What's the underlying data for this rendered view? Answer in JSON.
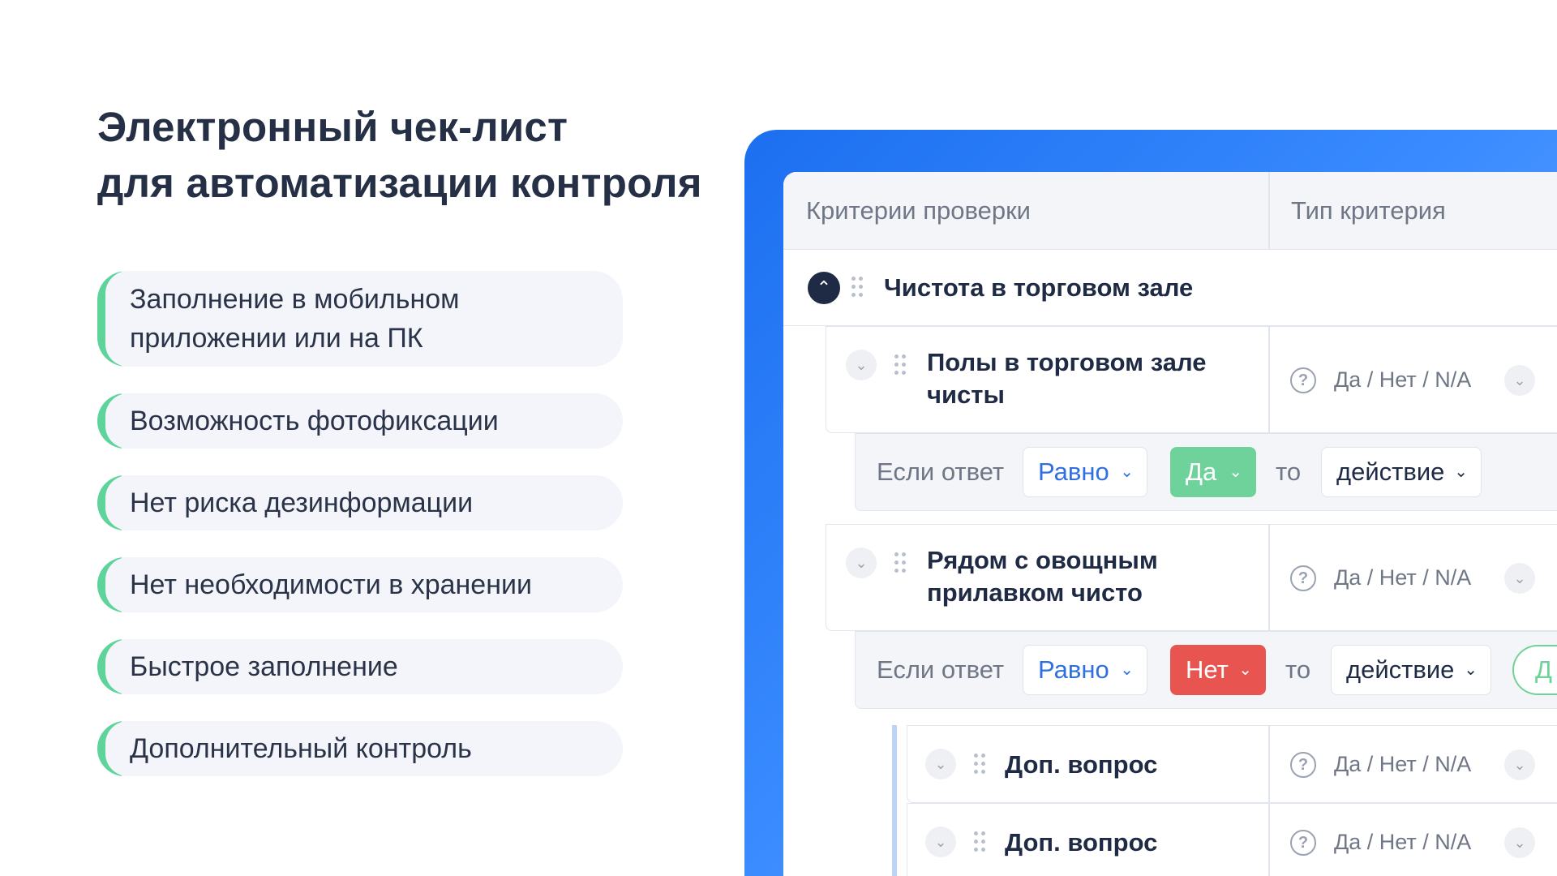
{
  "headline": {
    "line1": "Электронный чек-лист",
    "line2": "для автоматизации контроля"
  },
  "features": [
    "Заполнение в мобильном",
    "приложении или на ПК",
    "Возможность фотофиксации",
    "Нет риска дезинформации",
    "Нет необходимости в хранении",
    "Быстрое заполнение",
    "Дополнительный контроль"
  ],
  "table": {
    "headers": {
      "criteria": "Критерии проверки",
      "type": "Тип критерия"
    },
    "group": {
      "title": "Чистота в торговом зале"
    },
    "items": [
      {
        "title_line1": "Полы в торговом зале",
        "title_line2": "чисты",
        "answer_type": "Да / Нет / N/A"
      },
      {
        "title_line1": "Рядом с овощным",
        "title_line2": "прилавком чисто",
        "answer_type": "Да / Нет / N/A"
      }
    ],
    "conditions": [
      {
        "if_label": "Если ответ",
        "operator": "Равно",
        "value": "Да",
        "then_label": "то",
        "action": "действие",
        "value_color": "#6fd29a"
      },
      {
        "if_label": "Если ответ",
        "operator": "Равно",
        "value": "Нет",
        "then_label": "то",
        "action": "действие",
        "value_color": "#e8544f",
        "extra_pill": "Д"
      }
    ],
    "sub_questions": [
      {
        "title": "Доп. вопрос",
        "answer_type": "Да / Нет / N/A"
      },
      {
        "title": "Доп. вопрос",
        "answer_type": "Да / Нет / N/A"
      }
    ]
  },
  "colors": {
    "accent_green": "#5fd49a",
    "brand_blue": "#1c6ff0",
    "text_dark": "#1f2a44",
    "danger_red": "#e8544f"
  },
  "icons": {
    "collapse": "chevron-up-icon",
    "expand": "chevron-down-icon",
    "drag": "drag-handle-icon",
    "help": "question-mark-icon"
  }
}
